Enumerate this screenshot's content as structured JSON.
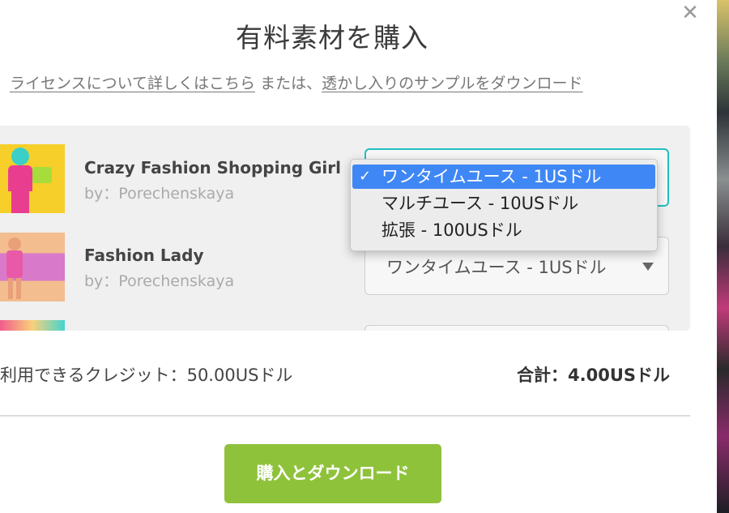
{
  "dialog": {
    "title": "有料素材を購入",
    "close_icon": "close-icon",
    "license_link": "ライセンスについて詳しくはこちら",
    "or_text": " または、",
    "sample_link": "透かし入りのサンプルをダウンロード"
  },
  "items": [
    {
      "name": "Crazy Fashion Shopping Girl",
      "author": "by：Porechenskaya",
      "selected_option": "ワンタイムユース - 1USドル"
    },
    {
      "name": "Fashion Lady",
      "author": "by：Porechenskaya",
      "selected_option": "ワンタイムユース - 1USドル"
    }
  ],
  "dropdown": {
    "options": [
      {
        "label": "ワンタイムユース - 1USドル",
        "selected": true,
        "check": "✓"
      },
      {
        "label": "マルチユース - 10USドル",
        "selected": false
      },
      {
        "label": "拡張 - 100USドル",
        "selected": false
      }
    ]
  },
  "summary": {
    "credits": "利用できるクレジット：50.00USドル",
    "total": "合計：4.00USドル"
  },
  "buy_button": "購入とダウンロード",
  "colors": {
    "accent_focus": "#21bfc0",
    "selected_option_bg": "#3f87f5",
    "buy_button_bg": "#8fc23b"
  }
}
